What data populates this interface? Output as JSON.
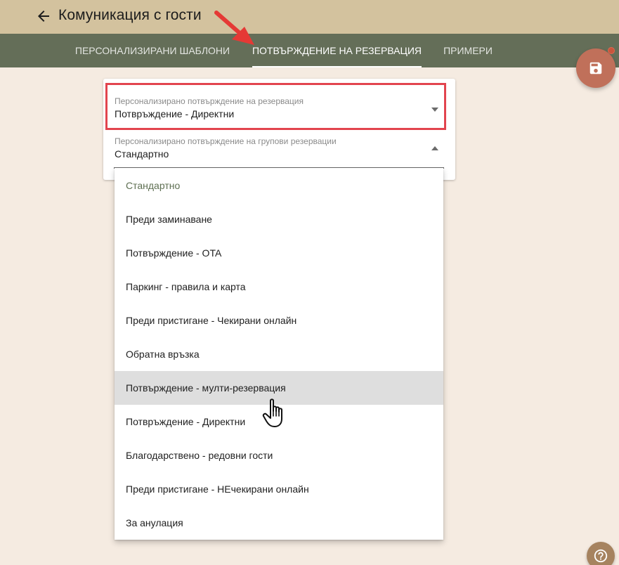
{
  "header": {
    "title": "Комуникация с гости"
  },
  "tabs": [
    {
      "label": "ПЕРСОНАЛИЗИРАНИ ШАБЛОНИ",
      "active": false
    },
    {
      "label": "ПОТВЪРЖДЕНИЕ НА РЕЗЕРВАЦИЯ",
      "active": true
    },
    {
      "label": "ПРИМЕРИ",
      "active": false
    }
  ],
  "form": {
    "field1": {
      "label": "Персонализирано потвърждение на резервация",
      "value": "Потвръждение - Директни"
    },
    "field2": {
      "label": "Персонализирано потвърждение на групови резервации",
      "value": "Стандартно"
    }
  },
  "dropdown": {
    "options": [
      "Стандартно",
      "Преди заминаване",
      "Потвърждение - OTA",
      "Паркинг - правила и карта",
      "Преди пристигане - Чекирани онлайн",
      "Обратна връзка",
      "Потвърждение - мулти-резервация",
      "Потвръждение - Директни",
      "Благодарствено - редовни гости",
      "Преди пристигане - НЕчекирани онлайн",
      "За анулация"
    ],
    "selected_index": 0,
    "hover_index": 6
  },
  "icons": {
    "back": "arrow-back-icon",
    "save": "save-icon",
    "help": "help-icon",
    "caret_down": "caret-down-icon",
    "caret_up": "caret-up-icon"
  },
  "colors": {
    "header_bg": "#d3c29e",
    "tabbar_bg": "#646e58",
    "page_bg": "#f5ebe1",
    "fab": "#c0705a",
    "highlight": "#e2444e",
    "annotation_arrow": "#e53935",
    "selected_option": "#5e6f52",
    "hover_option_bg": "#dedede"
  }
}
